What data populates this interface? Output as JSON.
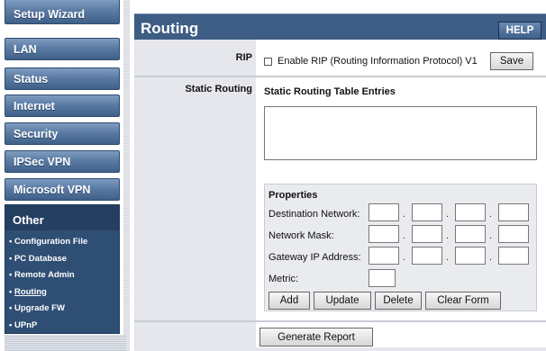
{
  "sidebar": {
    "buttons": [
      "Setup Wizard",
      "LAN",
      "Status",
      "Internet",
      "Security",
      "IPSec VPN",
      "Microsoft VPN"
    ],
    "other_heading": "Other",
    "bullet": "•",
    "sub_items": [
      "Configuration File",
      "PC Database",
      "Remote Admin",
      "Routing",
      "Upgrade FW",
      "UPnP"
    ],
    "active_sub_item": "Routing"
  },
  "header": {
    "title": "Routing",
    "help_label": "HELP"
  },
  "rip": {
    "label": "RIP",
    "checkbox_text": "Enable RIP (Routing Information Protocol) V1",
    "checked": false,
    "save_label": "Save"
  },
  "static_routing": {
    "label": "Static Routing",
    "table_title": "Static Routing Table Entries",
    "properties": {
      "title": "Properties",
      "destination_label": "Destination Network:",
      "mask_label": "Network Mask:",
      "gateway_label": "Gateway IP Address:",
      "metric_label": "Metric:",
      "dot": "."
    },
    "buttons": {
      "add": "Add",
      "update": "Update",
      "delete": "Delete",
      "clear": "Clear Form"
    }
  },
  "footer": {
    "generate_report": "Generate Report"
  }
}
